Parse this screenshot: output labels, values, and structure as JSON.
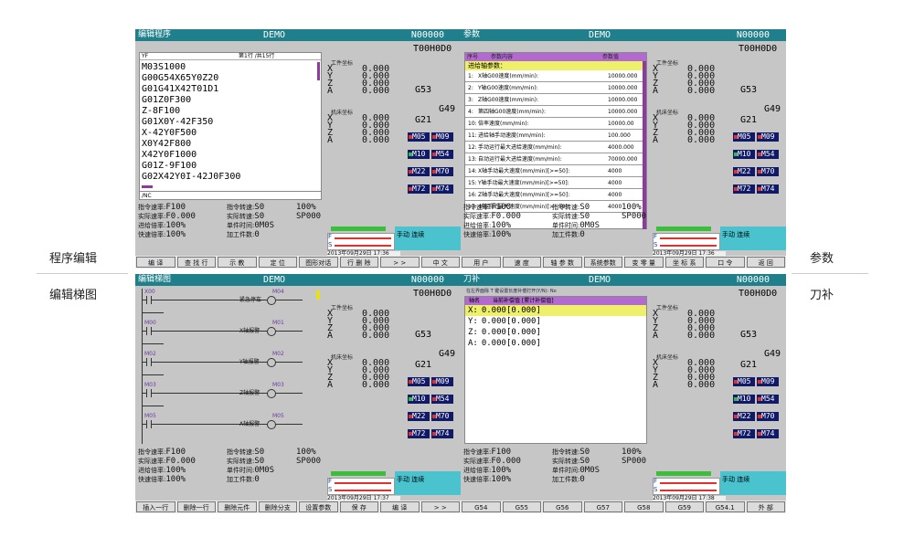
{
  "side_labels": {
    "tl": "程序编辑",
    "bl": "编辑梯图",
    "tr": "参数",
    "br": "刀补"
  },
  "common": {
    "title_center": "DEMO",
    "tool": "T00H0D0",
    "work_coord_label": "工件坐标",
    "mach_coord_label": "机床坐标",
    "work_axes": [
      {
        "a": "X",
        "v": "0.000"
      },
      {
        "a": "Y",
        "v": "0.000"
      },
      {
        "a": "Z",
        "v": "0.000"
      },
      {
        "a": "A",
        "v": "0.000"
      }
    ],
    "mach_axes": [
      {
        "a": "X",
        "v": "0.000"
      },
      {
        "a": "Y",
        "v": "0.000"
      },
      {
        "a": "Z",
        "v": "0.000"
      },
      {
        "a": "A",
        "v": "0.000"
      }
    ],
    "g53": "G53",
    "g49": "G49",
    "g21": "G21",
    "mcodes": [
      {
        "c": "M05",
        "on": "#e0312d"
      },
      {
        "c": "M09",
        "on": "#e0312d"
      },
      {
        "c": "M10",
        "on": "#2fbf3a"
      },
      {
        "c": "M54",
        "on": "#e0312d"
      },
      {
        "c": "M22",
        "on": "#e0312d"
      },
      {
        "c": "M70",
        "on": "#e0312d"
      },
      {
        "c": "M72",
        "on": "#e0312d"
      },
      {
        "c": "M74",
        "on": "#e0312d"
      }
    ],
    "b1_l": "指令速率:",
    "b1_v": "F100",
    "b2_l": "实际速率:",
    "b2_v": "F0.000",
    "b3_l": "进给倍率:",
    "b3_v": "100%",
    "b4_l": "快速倍率:",
    "b4_v": "100%",
    "c1_l": "指令转速:",
    "c1_v": "S0",
    "c2_l": "实际转速:",
    "c2_v": "S0",
    "c3_l": "单件时间:",
    "c3_v": "0M0S",
    "c4_l": "加工件数:",
    "c4_v": "0",
    "d1": "100%",
    "d2": "SP000",
    "mode": "手动 连续",
    "gauge_f": "F",
    "gauge_s": "S",
    "prog_no": "N00000"
  },
  "tl": {
    "title": "编辑程序",
    "date": "2013年09月29日 17:36",
    "file": "YF",
    "line_info": "第1行  /共15行",
    "program": [
      "M03S1000",
      "G00G54X65Y0Z20",
      "G01G41X42T01D1",
      "G01Z0F300",
      "Z-8F100",
      "G01X0Y-42F350",
      "X-42Y0F500",
      "X0Y42F800",
      "X42Y0F1000",
      "G01Z-9F100",
      "G02X42Y0I-42J0F300"
    ],
    "cmd": "/NC",
    "softkeys": [
      "编 译",
      "查 找 行",
      "示 教",
      "定 位",
      "图形对话",
      "行 删 除",
      "> >",
      "中 文"
    ]
  },
  "tr": {
    "title": "参数",
    "date": "2013年09月29日 17:36",
    "col1": "序号",
    "col2": "参数内容",
    "col3": "参数值",
    "section": "进给轴参数：",
    "params": [
      {
        "n": "1:",
        "t": "X轴G00速度(mm/min):",
        "v": "10000.000"
      },
      {
        "n": "2:",
        "t": "Y轴G00速度(mm/min):",
        "v": "10000.000"
      },
      {
        "n": "3:",
        "t": "Z轴G00速度(mm/min):",
        "v": "10000.000"
      },
      {
        "n": "4:",
        "t": "第四轴G00速度(mm/min):",
        "v": "10000.000"
      },
      {
        "n": "10:",
        "t": "倍率速度(mm/min):",
        "v": "10000.00"
      },
      {
        "n": "11:",
        "t": "进给轴手动速度(mm/min):",
        "v": "100.000"
      },
      {
        "n": "12:",
        "t": "手动运行最大进给速度(mm/min):",
        "v": "4000.000"
      },
      {
        "n": "13:",
        "t": "自动运行最大进给速度(mm/min):",
        "v": "70000.000"
      },
      {
        "n": "14:",
        "t": "X轴手动最大速度(mm/min)[>=50]:",
        "v": "4000"
      },
      {
        "n": "15:",
        "t": "Y轴手动最大速度(mm/min)[>=50]:",
        "v": "4000"
      },
      {
        "n": "16:",
        "t": "Z轴手动最大速度(mm/min)[>=50]:",
        "v": "4000"
      },
      {
        "n": "17:",
        "t": "4轴手动最大速度(mm/min)[>=50]:",
        "v": "4000"
      }
    ],
    "softkeys": [
      "用 户",
      "速 度",
      "轴 参 数",
      "系统参数",
      "变 零 量",
      "坐 标 系",
      "口 令",
      "返 回"
    ]
  },
  "bl": {
    "title": "编辑梯图",
    "date": "2013年09月29日 17:37",
    "rungs": [
      {
        "l": "X00",
        "r": "紧急停车",
        "o": "M04"
      },
      {
        "l": "M00",
        "r": "X轴报警",
        "o": "M01"
      },
      {
        "l": "M02",
        "r": "Y轴报警",
        "o": "M02"
      },
      {
        "l": "M03",
        "r": "Z轴报警",
        "o": "M03"
      },
      {
        "l": "M05",
        "r": "A轴报警",
        "o": "M05"
      }
    ],
    "softkeys": [
      "插入一行",
      "删除一行",
      "删除元件",
      "删除分支",
      "设置参数",
      "保 存",
      "编 译",
      "> >"
    ]
  },
  "br": {
    "title": "刀补",
    "date": "2013年09月29日 17:38",
    "hint": "在左界面除 T 键设置长度补偿打开(Y/N): No",
    "col1": "轴名",
    "col2": "当前补偿值 [累计补偿值]",
    "offsets": [
      {
        "a": "X:",
        "v": "0.000",
        "c": "[0.000]"
      },
      {
        "a": "Y:",
        "v": "0.000",
        "c": "[0.000]"
      },
      {
        "a": "Z:",
        "v": "0.000",
        "c": "[0.000]"
      },
      {
        "a": "A:",
        "v": "0.000",
        "c": "[0.000]"
      }
    ],
    "softkeys": [
      "G54",
      "G55",
      "G56",
      "G57",
      "G58",
      "G59",
      "G54.1",
      "外 部"
    ]
  }
}
